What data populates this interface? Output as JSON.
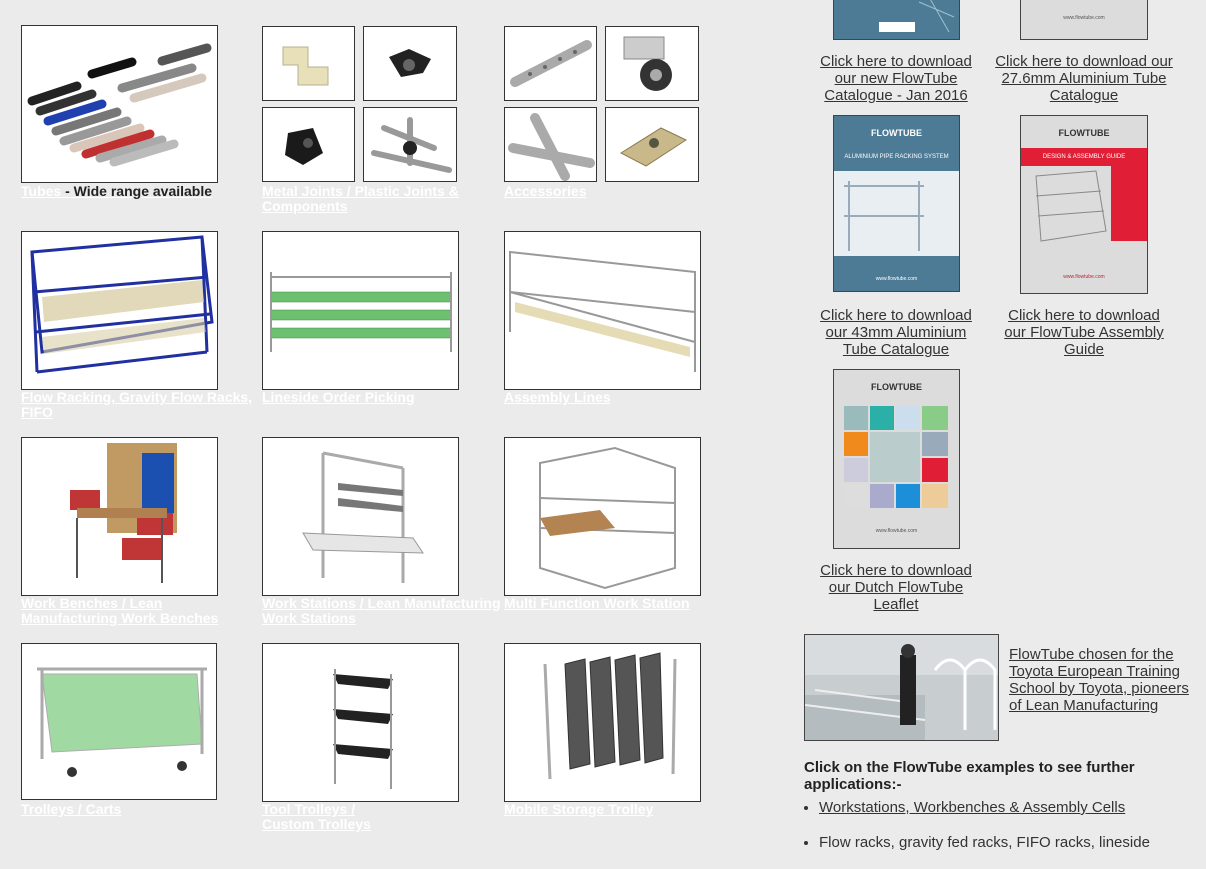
{
  "products": {
    "tubes": {
      "link": "Tubes",
      "suffix": " - Wide range available"
    },
    "joints": {
      "label": "Metal Joints / Plastic Joints & Components"
    },
    "accessories": {
      "label": "Accessories"
    },
    "flow_racking": {
      "label": "Flow Racking, Gravity Flow Racks, FIFO"
    },
    "lineside": {
      "label": "Lineside Order Picking"
    },
    "assembly": {
      "label": "Assembly Lines"
    },
    "work_benches": {
      "label": "Work Benches / Lean Manufacturing Work Benches"
    },
    "work_stations": {
      "label": "Work Stations / Lean Manufacturing Work Stations"
    },
    "multi_function": {
      "label": "Multi Function Work Station"
    },
    "trolleys": {
      "label": "Trolleys / Carts"
    },
    "tool_trolleys": {
      "label": "Tool Trolleys / Custom Trolleys"
    },
    "mobile_storage": {
      "label": "Mobile Storage Trolley"
    }
  },
  "downloads": {
    "new_catalogue": "Click here to download our new FlowTube Catalogue - Jan 2016",
    "tube_27": "Click here to download our 27.6mm Aluminium Tube Catalogue",
    "tube_43": "Click here to download our 43mm Aluminium Tube Catalogue",
    "assembly_guide": "Click here to download our FlowTube Assembly Guide",
    "dutch_leaflet": "Click here to download our Dutch FlowTube Leaflet"
  },
  "covers": {
    "brand": "FLOWTUBE",
    "pipe_title": "ALUMINIUM PIPE RACKING SYSTEM",
    "guide_title": "DESIGN & ASSEMBLY GUIDE",
    "site": "www.flowtube.com"
  },
  "news": {
    "text": "FlowTube chosen for the Toyota European Training School by Toyota, pioneers of Lean Manufacturing"
  },
  "applications": {
    "heading": "Click on the FlowTube examples to see further applications:-",
    "items": [
      "Workstations, Workbenches & Assembly Cells",
      "Flow racks, gravity fed racks, FIFO racks, lineside"
    ]
  },
  "colors": {
    "page_bg": "#ebebeb",
    "cover_blue": "#4d7a94",
    "cover_red": "#e01f36"
  }
}
